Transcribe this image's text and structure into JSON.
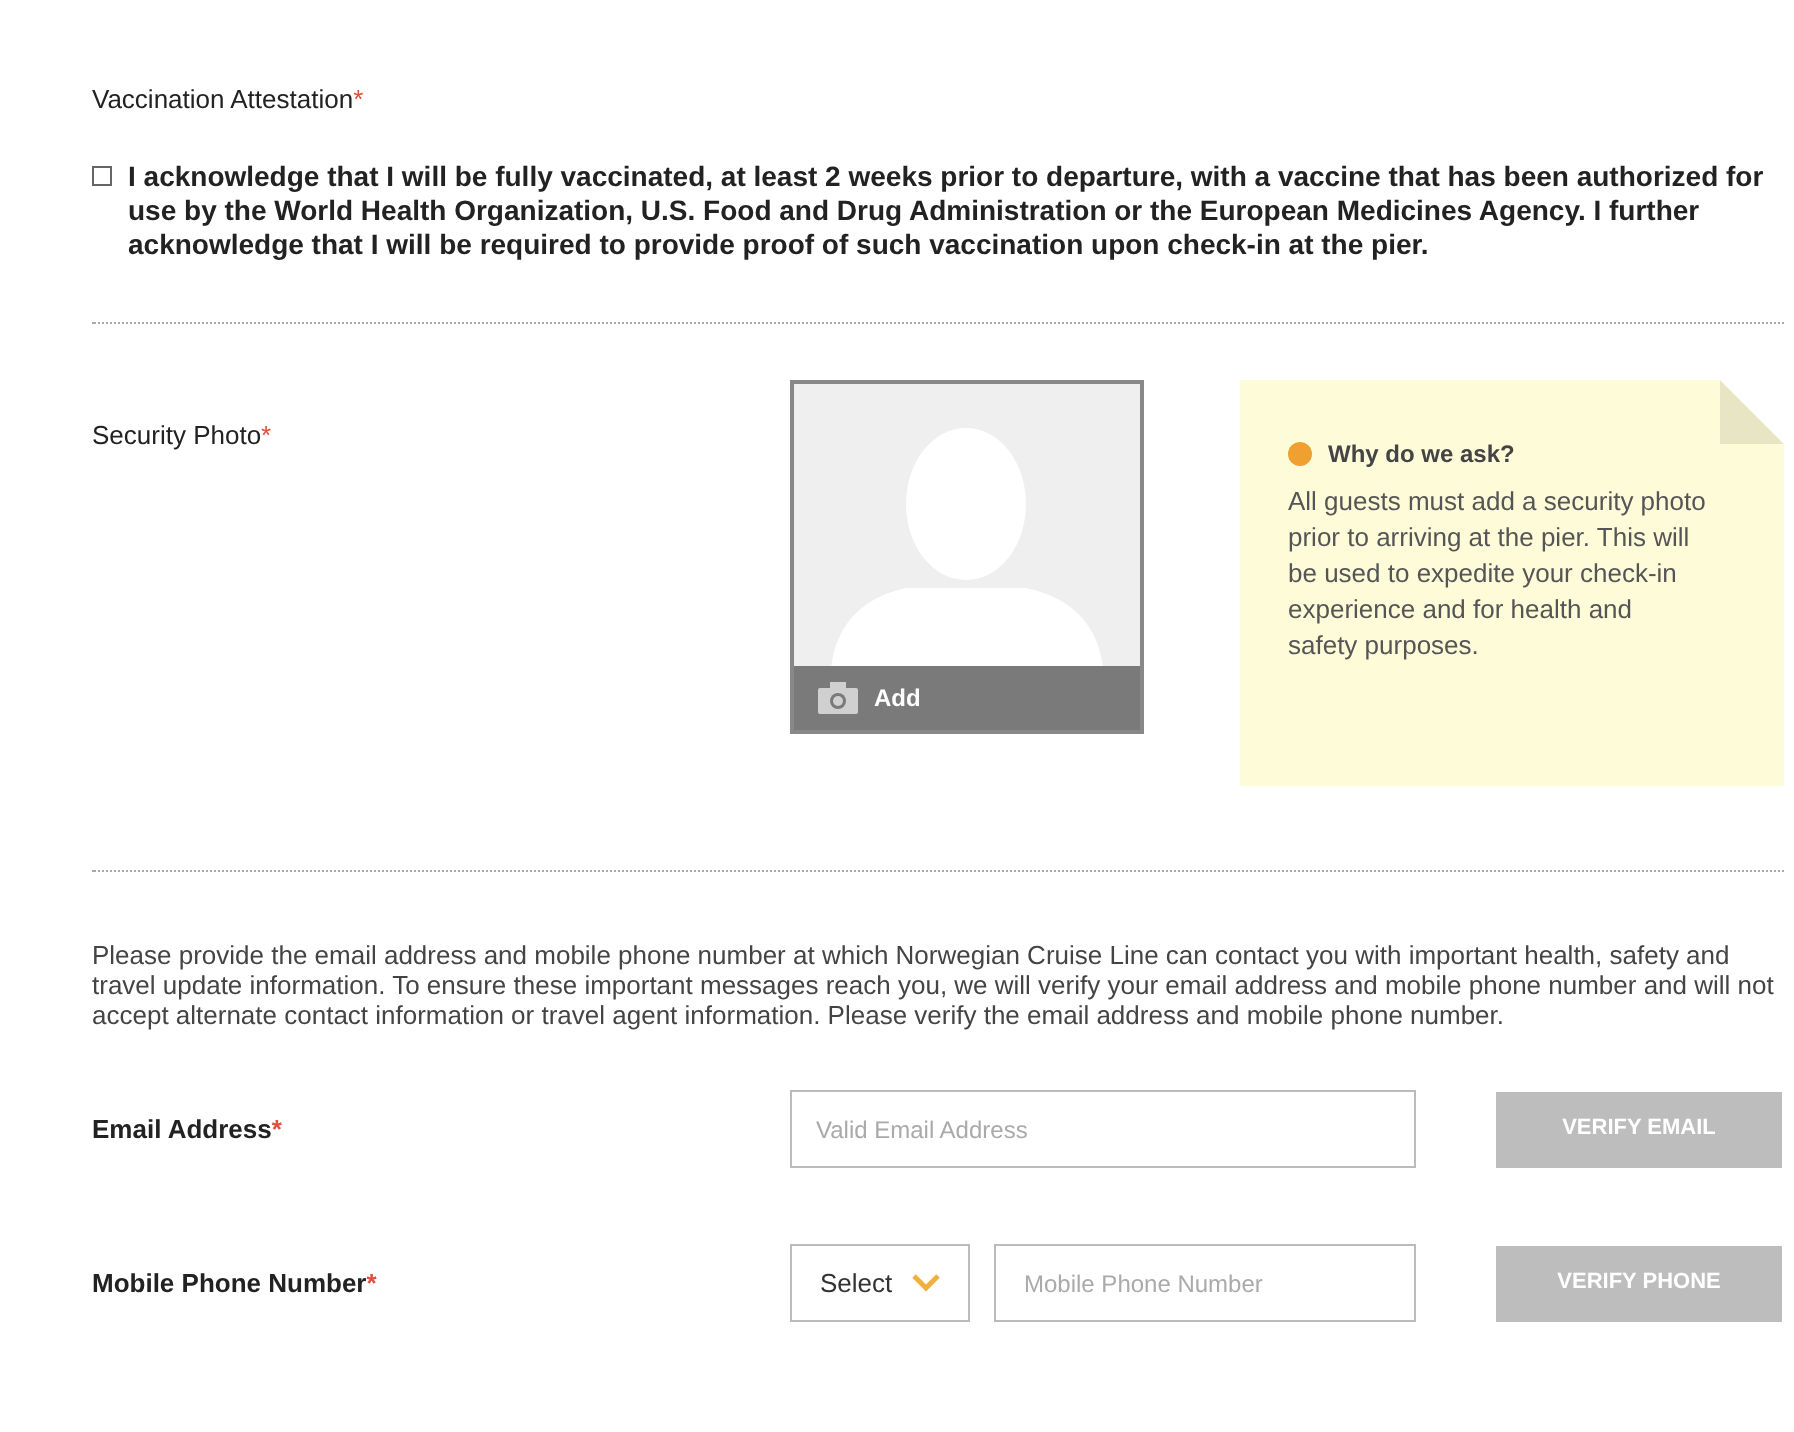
{
  "vaccination": {
    "label": "Vaccination Attestation",
    "required_mark": "*",
    "checked": false,
    "text": "I acknowledge that I will be fully vaccinated, at least 2 weeks prior to departure, with a vaccine that has been authorized for use by the World Health Organization, U.S. Food and Drug Administration or the European Medicines Agency. I further acknowledge that I will be required to provide proof of such vaccination upon check-in at the pier."
  },
  "security_photo": {
    "label": "Security Photo",
    "required_mark": "*",
    "add_label": "Add"
  },
  "info_note": {
    "title": "Why do we ask?",
    "text": "All guests must add a security photo prior to arriving at the pier. This will be used to expedite your check-in experience and for health and safety purposes."
  },
  "contact_intro": "Please provide the email address and mobile phone number at which Norwegian Cruise Line can contact you with important health, safety and travel update information. To ensure these important messages reach you, we will verify your email address and mobile phone number and will not accept alternate contact information or travel agent information. Please verify the email address and mobile phone number.",
  "email": {
    "label": "Email Address",
    "required_mark": "*",
    "placeholder": "Valid Email Address",
    "button": {
      "label": "VERIFY EMAIL",
      "disabled": true
    }
  },
  "phone": {
    "label": "Mobile Phone Number",
    "required_mark": "*",
    "country_select": "Select",
    "placeholder": "Mobile Phone Number",
    "button": {
      "label": "VERIFY PHONE",
      "disabled": true
    }
  }
}
